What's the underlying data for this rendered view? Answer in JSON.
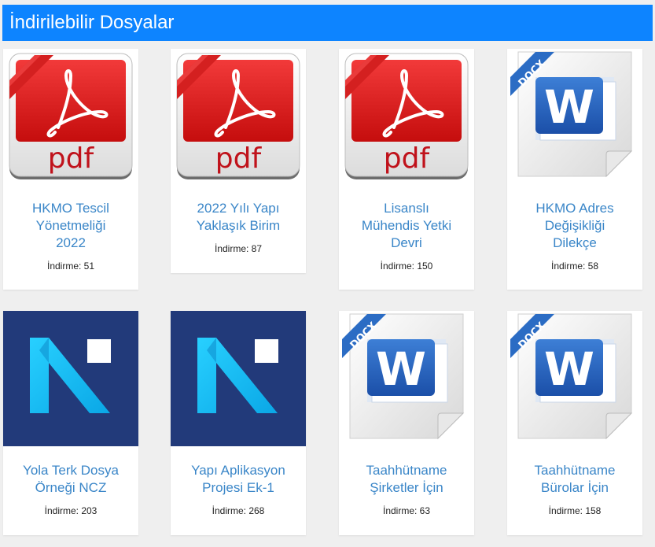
{
  "header": {
    "title": "İndirilebilir Dosyalar"
  },
  "colors": {
    "header_bg": "#0d84ff",
    "title_link": "#3a86c8",
    "ncz_bg": "#223a7a",
    "ncz_accent": "#1ec4f5"
  },
  "downloads_prefix": "İndirme:",
  "files": [
    {
      "icon": "pdf-icon",
      "title_lines": [
        "HKMO Tescil",
        "Yönetmeliği",
        "2022"
      ],
      "downloads": "İndirme: 51"
    },
    {
      "icon": "pdf-icon",
      "title_lines": [
        "2022 Yılı Yapı",
        "Yaklaşık Birim"
      ],
      "downloads": "İndirme: 87"
    },
    {
      "icon": "pdf-icon",
      "title_lines": [
        "Lisanslı",
        "Mühendis Yetki",
        "Devri"
      ],
      "downloads": "İndirme: 150"
    },
    {
      "icon": "docx-word-icon",
      "icon_badge": "DOCX",
      "title_lines": [
        "HKMO Adres",
        "Değişikliği",
        "Dilekçe"
      ],
      "downloads": "İndirme: 58"
    },
    {
      "icon": "ncz-logo-icon",
      "title_lines": [
        "Yola Terk Dosya",
        "Örneği NCZ"
      ],
      "downloads": "İndirme: 203"
    },
    {
      "icon": "ncz-logo-icon",
      "title_lines": [
        "Yapı Aplikasyon",
        "Projesi Ek-1"
      ],
      "downloads": "İndirme: 268"
    },
    {
      "icon": "docx-word-icon",
      "icon_badge": "DOCX",
      "title_lines": [
        "Taahhütname",
        "Şirketler İçin"
      ],
      "downloads": "İndirme: 63"
    },
    {
      "icon": "docx-word-icon",
      "icon_badge": "DOCX",
      "title_lines": [
        "Taahhütname",
        "Bürolar İçin"
      ],
      "downloads": "İndirme: 158"
    }
  ]
}
